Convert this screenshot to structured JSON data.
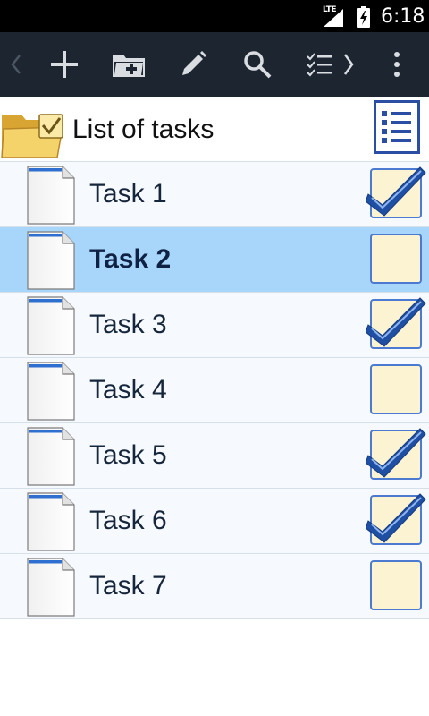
{
  "status_bar": {
    "network": "LTE",
    "time": "6:18"
  },
  "toolbar": {
    "buttons": [
      {
        "name": "back-button",
        "icon": "chevron-left-icon",
        "enabled": false
      },
      {
        "name": "add-task-button",
        "icon": "plus-icon"
      },
      {
        "name": "add-folder-button",
        "icon": "folder-plus-icon"
      },
      {
        "name": "edit-button",
        "icon": "pencil-icon"
      },
      {
        "name": "search-button",
        "icon": "search-icon"
      },
      {
        "name": "checklist-next-button",
        "icon": "checklist-chevron-icon"
      },
      {
        "name": "more-options-button",
        "icon": "more-vert-icon"
      }
    ]
  },
  "header": {
    "title": "List of tasks",
    "folder_icon": "folder-check-icon",
    "list_icon": "checklist-icon"
  },
  "tasks": [
    {
      "label": "Task 1",
      "checked": true,
      "selected": false
    },
    {
      "label": "Task 2",
      "checked": false,
      "selected": true
    },
    {
      "label": "Task 3",
      "checked": true,
      "selected": false
    },
    {
      "label": "Task 4",
      "checked": false,
      "selected": false
    },
    {
      "label": "Task 5",
      "checked": true,
      "selected": false
    },
    {
      "label": "Task 6",
      "checked": true,
      "selected": false
    },
    {
      "label": "Task 7",
      "checked": false,
      "selected": false
    }
  ],
  "colors": {
    "toolbar_bg": "#1c2530",
    "row_bg": "#f6f9fd",
    "selected_row_bg": "#a8d6fb",
    "check_blue": "#1f4fa3",
    "checkbox_fill": "#fbf3d2"
  }
}
